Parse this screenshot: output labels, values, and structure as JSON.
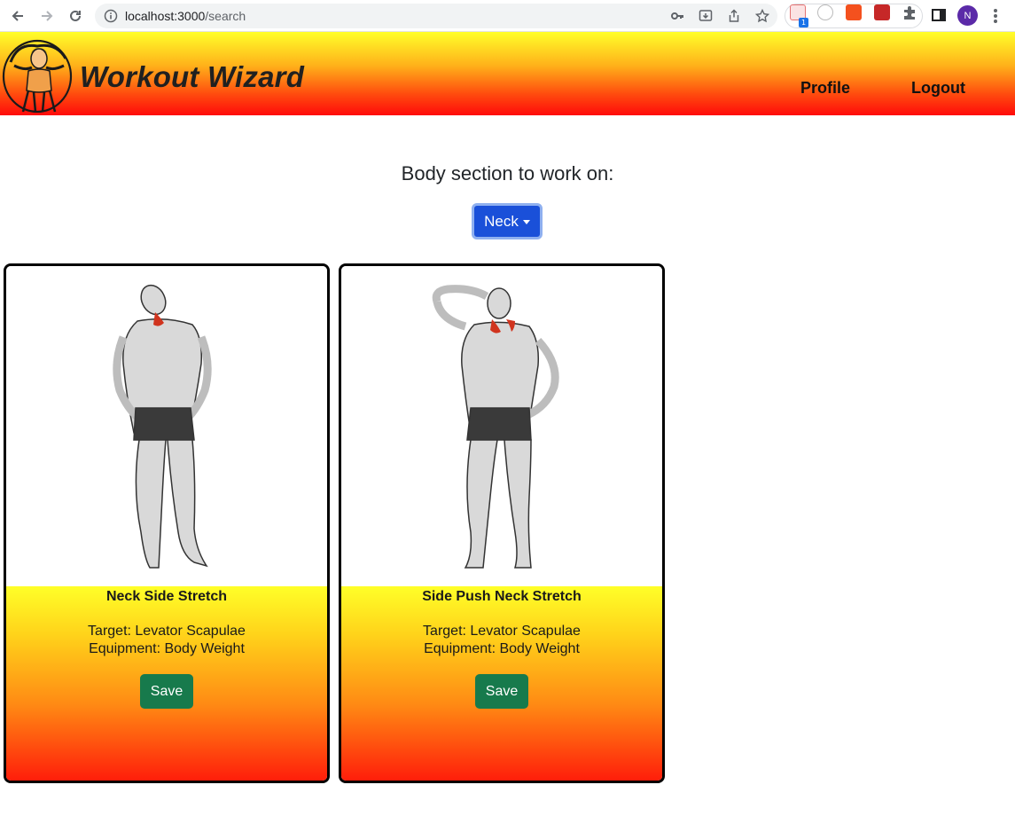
{
  "browser": {
    "url_host": "localhost:3000",
    "url_path": "/search",
    "extension_badge": "1",
    "profile_initial": "N"
  },
  "header": {
    "brand": "Workout Wizard",
    "nav": [
      {
        "label": "Profile"
      },
      {
        "label": "Logout"
      }
    ]
  },
  "search": {
    "section_label": "Body section to work on:",
    "selected_body_part": "Neck"
  },
  "exercises": [
    {
      "name": "Neck Side Stretch",
      "target": "Target: Levator Scapulae",
      "equipment": "Equipment: Body Weight",
      "save_label": "Save"
    },
    {
      "name": "Side Push Neck Stretch",
      "target": "Target: Levator Scapulae",
      "equipment": "Equipment: Body Weight",
      "save_label": "Save"
    }
  ],
  "colors": {
    "header_gradient_top": "#ffff2a",
    "header_gradient_bottom": "#ff0a0a",
    "dropdown_bg": "#1a50d9",
    "save_button_bg": "#177a4c"
  }
}
